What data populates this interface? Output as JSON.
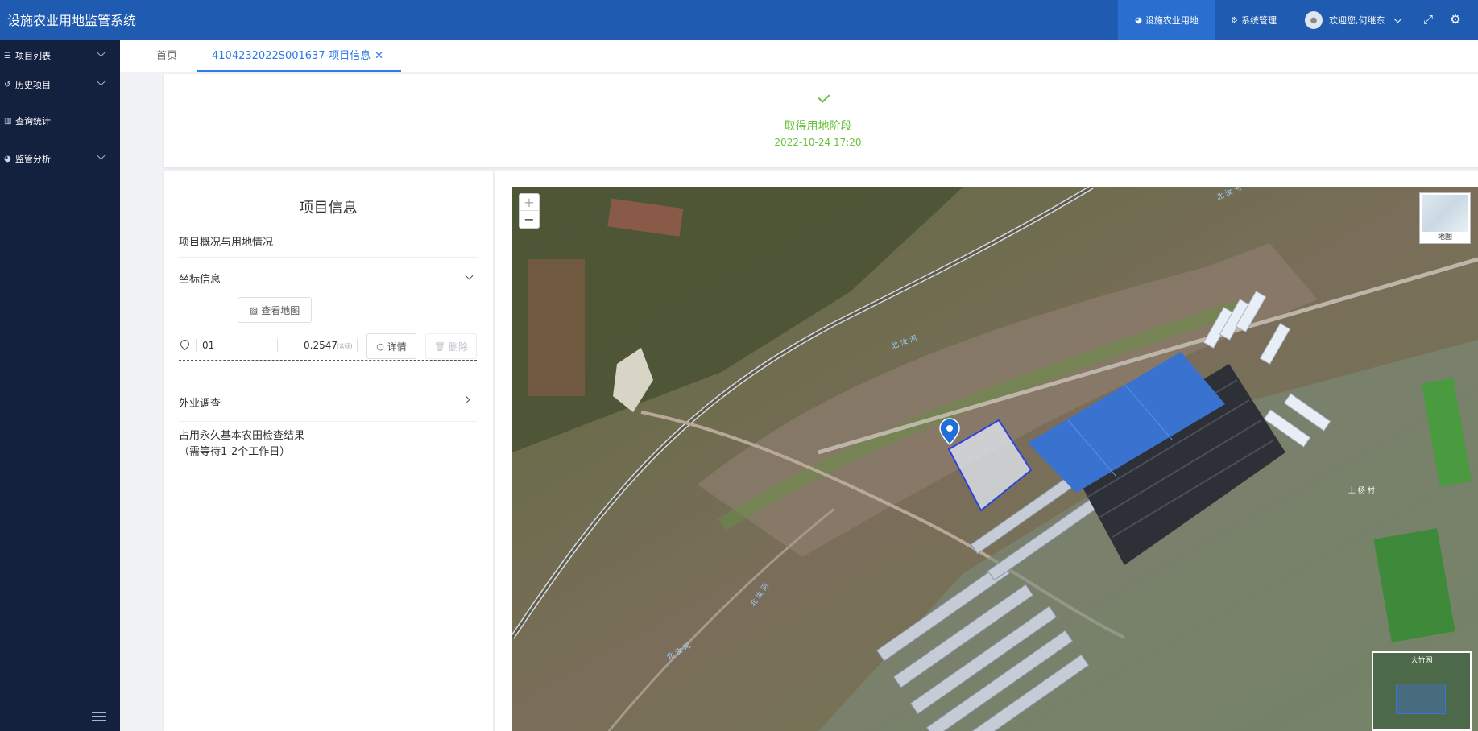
{
  "header": {
    "title": "设施农业用地监管系统",
    "nav_active": "设施农业用地",
    "nav_system": "系统管理",
    "user_greeting": "欢迎您,何继东"
  },
  "sidebar": {
    "items": [
      {
        "label": "项目列表",
        "icon": "list-icon",
        "has_chevron": true
      },
      {
        "label": "历史项目",
        "icon": "history-icon",
        "has_chevron": true
      },
      {
        "label": "查询统计",
        "icon": "chart-bar-icon",
        "has_chevron": false
      },
      {
        "label": "监管分析",
        "icon": "pie-chart-icon",
        "has_chevron": true
      }
    ]
  },
  "tabs": {
    "home": "首页",
    "active": "4104232022S001637-项目信息"
  },
  "status": {
    "stage": "取得用地阶段",
    "time": "2022-10-24 17:20"
  },
  "info": {
    "title": "项目信息",
    "section_overview": "项目概况与用地情况",
    "section_coords": "坐标信息",
    "view_map_btn": "查看地图",
    "coord": {
      "id": "01",
      "area": "0.2547",
      "unit": "(公顷)",
      "detail_btn": "详情",
      "delete_btn": "删除"
    },
    "section_survey": "外业调查",
    "farmland_result": "占用永久基本农田检查结果",
    "farmland_note": "（需等待1-2个工作日）"
  },
  "map": {
    "zoom_in": "+",
    "zoom_out": "−",
    "layer_label": "地图",
    "overview_label": "大竹园",
    "place_labels": [
      {
        "text": "北 汝 河"
      },
      {
        "text": "北 汝 河"
      },
      {
        "text": "北 汝 河"
      },
      {
        "text": "北 汝 河"
      },
      {
        "text": "上 杨 村"
      }
    ]
  },
  "colors": {
    "header_bg": "#1f5bb0",
    "sidebar_bg": "#13213f",
    "accent": "#2d7be8",
    "success": "#67c23a"
  }
}
